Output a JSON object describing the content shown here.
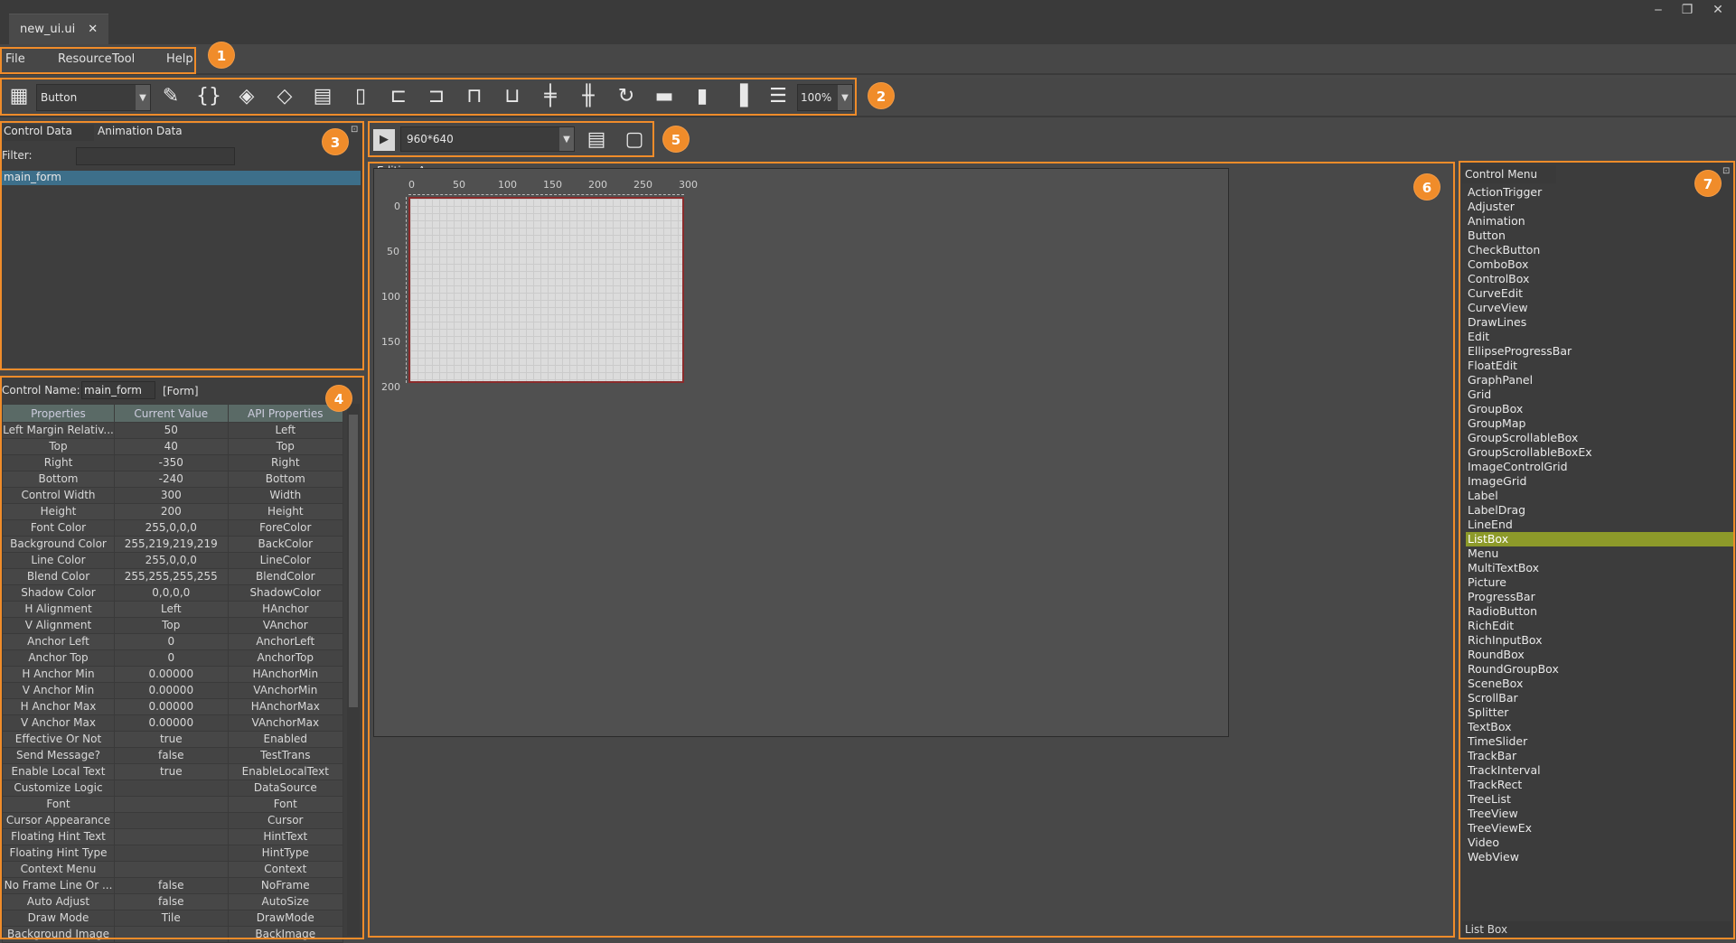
{
  "window": {
    "tab_title": "new_ui.ui",
    "close_glyph": "✕",
    "minimize_glyph": "‒",
    "restore_glyph": "❐"
  },
  "menu": {
    "items": [
      "File",
      "Resource",
      "Tool",
      "Help"
    ]
  },
  "callouts": [
    "1",
    "2",
    "3",
    "4",
    "5",
    "6",
    "7"
  ],
  "toolbar": {
    "control_select": "Button",
    "zoom": "100%",
    "icons": [
      "grid-icon",
      "edit-brush-icon",
      "braces-icon",
      "layer-up-icon",
      "layer-down-icon",
      "remove-page-icon",
      "page-icon",
      "align-left-icon",
      "align-right-icon",
      "align-top-icon",
      "align-bottom-icon",
      "center-horizontal-icon",
      "center-vertical-icon",
      "rotate-icon",
      "same-width-icon",
      "same-height-icon",
      "distribute-icon",
      "sliders-icon"
    ]
  },
  "control_data_panel": {
    "tabs": [
      "Control Data",
      "Animation Data"
    ],
    "filter_label": "Filter:",
    "filter_value": "",
    "tree_items": [
      "main_form"
    ]
  },
  "property_panel": {
    "control_name_label": "Control Name:",
    "control_name_value": "main_form",
    "control_type": "[Form]",
    "columns": [
      "Properties",
      "Current Value",
      "API Properties"
    ],
    "rows": [
      [
        "Left Margin Relativ...",
        "50",
        "Left"
      ],
      [
        "Top",
        "40",
        "Top"
      ],
      [
        "Right",
        "-350",
        "Right"
      ],
      [
        "Bottom",
        "-240",
        "Bottom"
      ],
      [
        "Control Width",
        "300",
        "Width"
      ],
      [
        "Height",
        "200",
        "Height"
      ],
      [
        "Font Color",
        "255,0,0,0",
        "ForeColor"
      ],
      [
        "Background Color",
        "255,219,219,219",
        "BackColor"
      ],
      [
        "Line Color",
        "255,0,0,0",
        "LineColor"
      ],
      [
        "Blend Color",
        "255,255,255,255",
        "BlendColor"
      ],
      [
        "Shadow Color",
        "0,0,0,0",
        "ShadowColor"
      ],
      [
        "H Alignment",
        "Left",
        "HAnchor"
      ],
      [
        "V Alignment",
        "Top",
        "VAnchor"
      ],
      [
        "Anchor Left",
        "0",
        "AnchorLeft"
      ],
      [
        "Anchor Top",
        "0",
        "AnchorTop"
      ],
      [
        "H Anchor Min",
        "0.00000",
        "HAnchorMin"
      ],
      [
        "V Anchor Min",
        "0.00000",
        "VAnchorMin"
      ],
      [
        "H Anchor Max",
        "0.00000",
        "HAnchorMax"
      ],
      [
        "V Anchor Max",
        "0.00000",
        "VAnchorMax"
      ],
      [
        "Effective Or Not",
        "true",
        "Enabled"
      ],
      [
        "Send Message?",
        "false",
        "TestTrans"
      ],
      [
        "Enable Local Text",
        "true",
        "EnableLocalText"
      ],
      [
        "Customize Logic",
        "",
        "DataSource"
      ],
      [
        "Font",
        "",
        "Font"
      ],
      [
        "Cursor Appearance",
        "",
        "Cursor"
      ],
      [
        "Floating Hint Text",
        "",
        "HintText"
      ],
      [
        "Floating Hint Type",
        "",
        "HintType"
      ],
      [
        "Context Menu",
        "",
        "Context"
      ],
      [
        "No Frame Line Or ...",
        "false",
        "NoFrame"
      ],
      [
        "Auto Adjust",
        "false",
        "AutoSize"
      ],
      [
        "Draw Mode",
        "Tile",
        "DrawMode"
      ],
      [
        "Background Image",
        "",
        "BackImage"
      ]
    ]
  },
  "preview_bar": {
    "resolution": "960*640"
  },
  "editing_area": {
    "title": "Editing Area",
    "x_ticks": [
      "0",
      "50",
      "100",
      "150",
      "200",
      "250",
      "300"
    ],
    "y_ticks": [
      "0",
      "50",
      "100",
      "150",
      "200"
    ]
  },
  "control_menu": {
    "title": "Control Menu",
    "items": [
      "ActionTrigger",
      "Adjuster",
      "Animation",
      "Button",
      "CheckButton",
      "ComboBox",
      "ControlBox",
      "CurveEdit",
      "CurveView",
      "DrawLines",
      "Edit",
      "EllipseProgressBar",
      "FloatEdit",
      "GraphPanel",
      "Grid",
      "GroupBox",
      "GroupMap",
      "GroupScrollableBox",
      "GroupScrollableBoxEx",
      "ImageControlGrid",
      "ImageGrid",
      "Label",
      "LabelDrag",
      "LineEnd",
      "ListBox",
      "Menu",
      "MultiTextBox",
      "Picture",
      "ProgressBar",
      "RadioButton",
      "RichEdit",
      "RichInputBox",
      "RoundBox",
      "RoundGroupBox",
      "SceneBox",
      "ScrollBar",
      "Splitter",
      "TextBox",
      "TimeSlider",
      "TrackBar",
      "TrackInterval",
      "TrackRect",
      "TreeList",
      "TreeView",
      "TreeViewEx",
      "Video",
      "WebView"
    ],
    "selected": "ListBox",
    "status": "List Box"
  }
}
